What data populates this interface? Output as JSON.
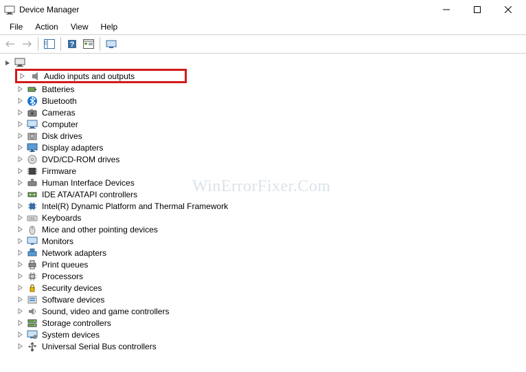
{
  "window": {
    "title": "Device Manager",
    "minimize_tooltip": "Minimize",
    "maximize_tooltip": "Maximize",
    "close_tooltip": "Close"
  },
  "menus": {
    "file": "File",
    "action": "Action",
    "view": "View",
    "help": "Help"
  },
  "toolbar": {
    "back": "Back",
    "forward": "Forward",
    "show_hide": "Show/Hide Console Tree",
    "help": "Help",
    "properties": "Properties",
    "devices": "Devices by type"
  },
  "tree": {
    "root": "",
    "categories": [
      {
        "label": "Audio inputs and outputs",
        "icon": "audio"
      },
      {
        "label": "Batteries",
        "icon": "battery"
      },
      {
        "label": "Bluetooth",
        "icon": "bluetooth"
      },
      {
        "label": "Cameras",
        "icon": "camera"
      },
      {
        "label": "Computer",
        "icon": "computer"
      },
      {
        "label": "Disk drives",
        "icon": "disk"
      },
      {
        "label": "Display adapters",
        "icon": "display"
      },
      {
        "label": "DVD/CD-ROM drives",
        "icon": "dvd"
      },
      {
        "label": "Firmware",
        "icon": "firmware"
      },
      {
        "label": "Human Interface Devices",
        "icon": "hid"
      },
      {
        "label": "IDE ATA/ATAPI controllers",
        "icon": "ide"
      },
      {
        "label": "Intel(R) Dynamic Platform and Thermal Framework",
        "icon": "chip"
      },
      {
        "label": "Keyboards",
        "icon": "keyboard"
      },
      {
        "label": "Mice and other pointing devices",
        "icon": "mouse"
      },
      {
        "label": "Monitors",
        "icon": "monitor"
      },
      {
        "label": "Network adapters",
        "icon": "network"
      },
      {
        "label": "Print queues",
        "icon": "printer"
      },
      {
        "label": "Processors",
        "icon": "processor"
      },
      {
        "label": "Security devices",
        "icon": "security"
      },
      {
        "label": "Software devices",
        "icon": "software"
      },
      {
        "label": "Sound, video and game controllers",
        "icon": "sound"
      },
      {
        "label": "Storage controllers",
        "icon": "storage"
      },
      {
        "label": "System devices",
        "icon": "system"
      },
      {
        "label": "Universal Serial Bus controllers",
        "icon": "usb"
      }
    ],
    "highlighted_index": 0
  },
  "watermark": "WinErrorFixer.Com"
}
